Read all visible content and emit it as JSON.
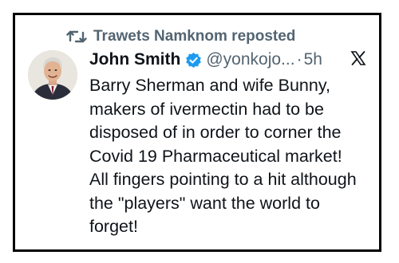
{
  "repost": {
    "icon": "repost-icon",
    "label": "Trawets Namknom reposted"
  },
  "author": {
    "name": "John Smith",
    "verified_icon": "verified-badge-icon",
    "handle": "@yonkojo...",
    "separator": "·",
    "time": "5h",
    "avatar_icon": "avatar"
  },
  "platform_logo": "x-logo-icon",
  "tweet": {
    "lines": [
      "Barry Sherman and wife Bunny,",
      "makers of ivermectin had to be",
      "disposed of in order to corner the",
      "Covid 19 Pharmaceutical market!",
      "All fingers pointing to a hit although",
      "the \"players\" want the world to",
      "forget!"
    ]
  },
  "colors": {
    "text": "#0f1419",
    "muted": "#536471",
    "verified": "#1d9bf0",
    "border": "#000000"
  }
}
